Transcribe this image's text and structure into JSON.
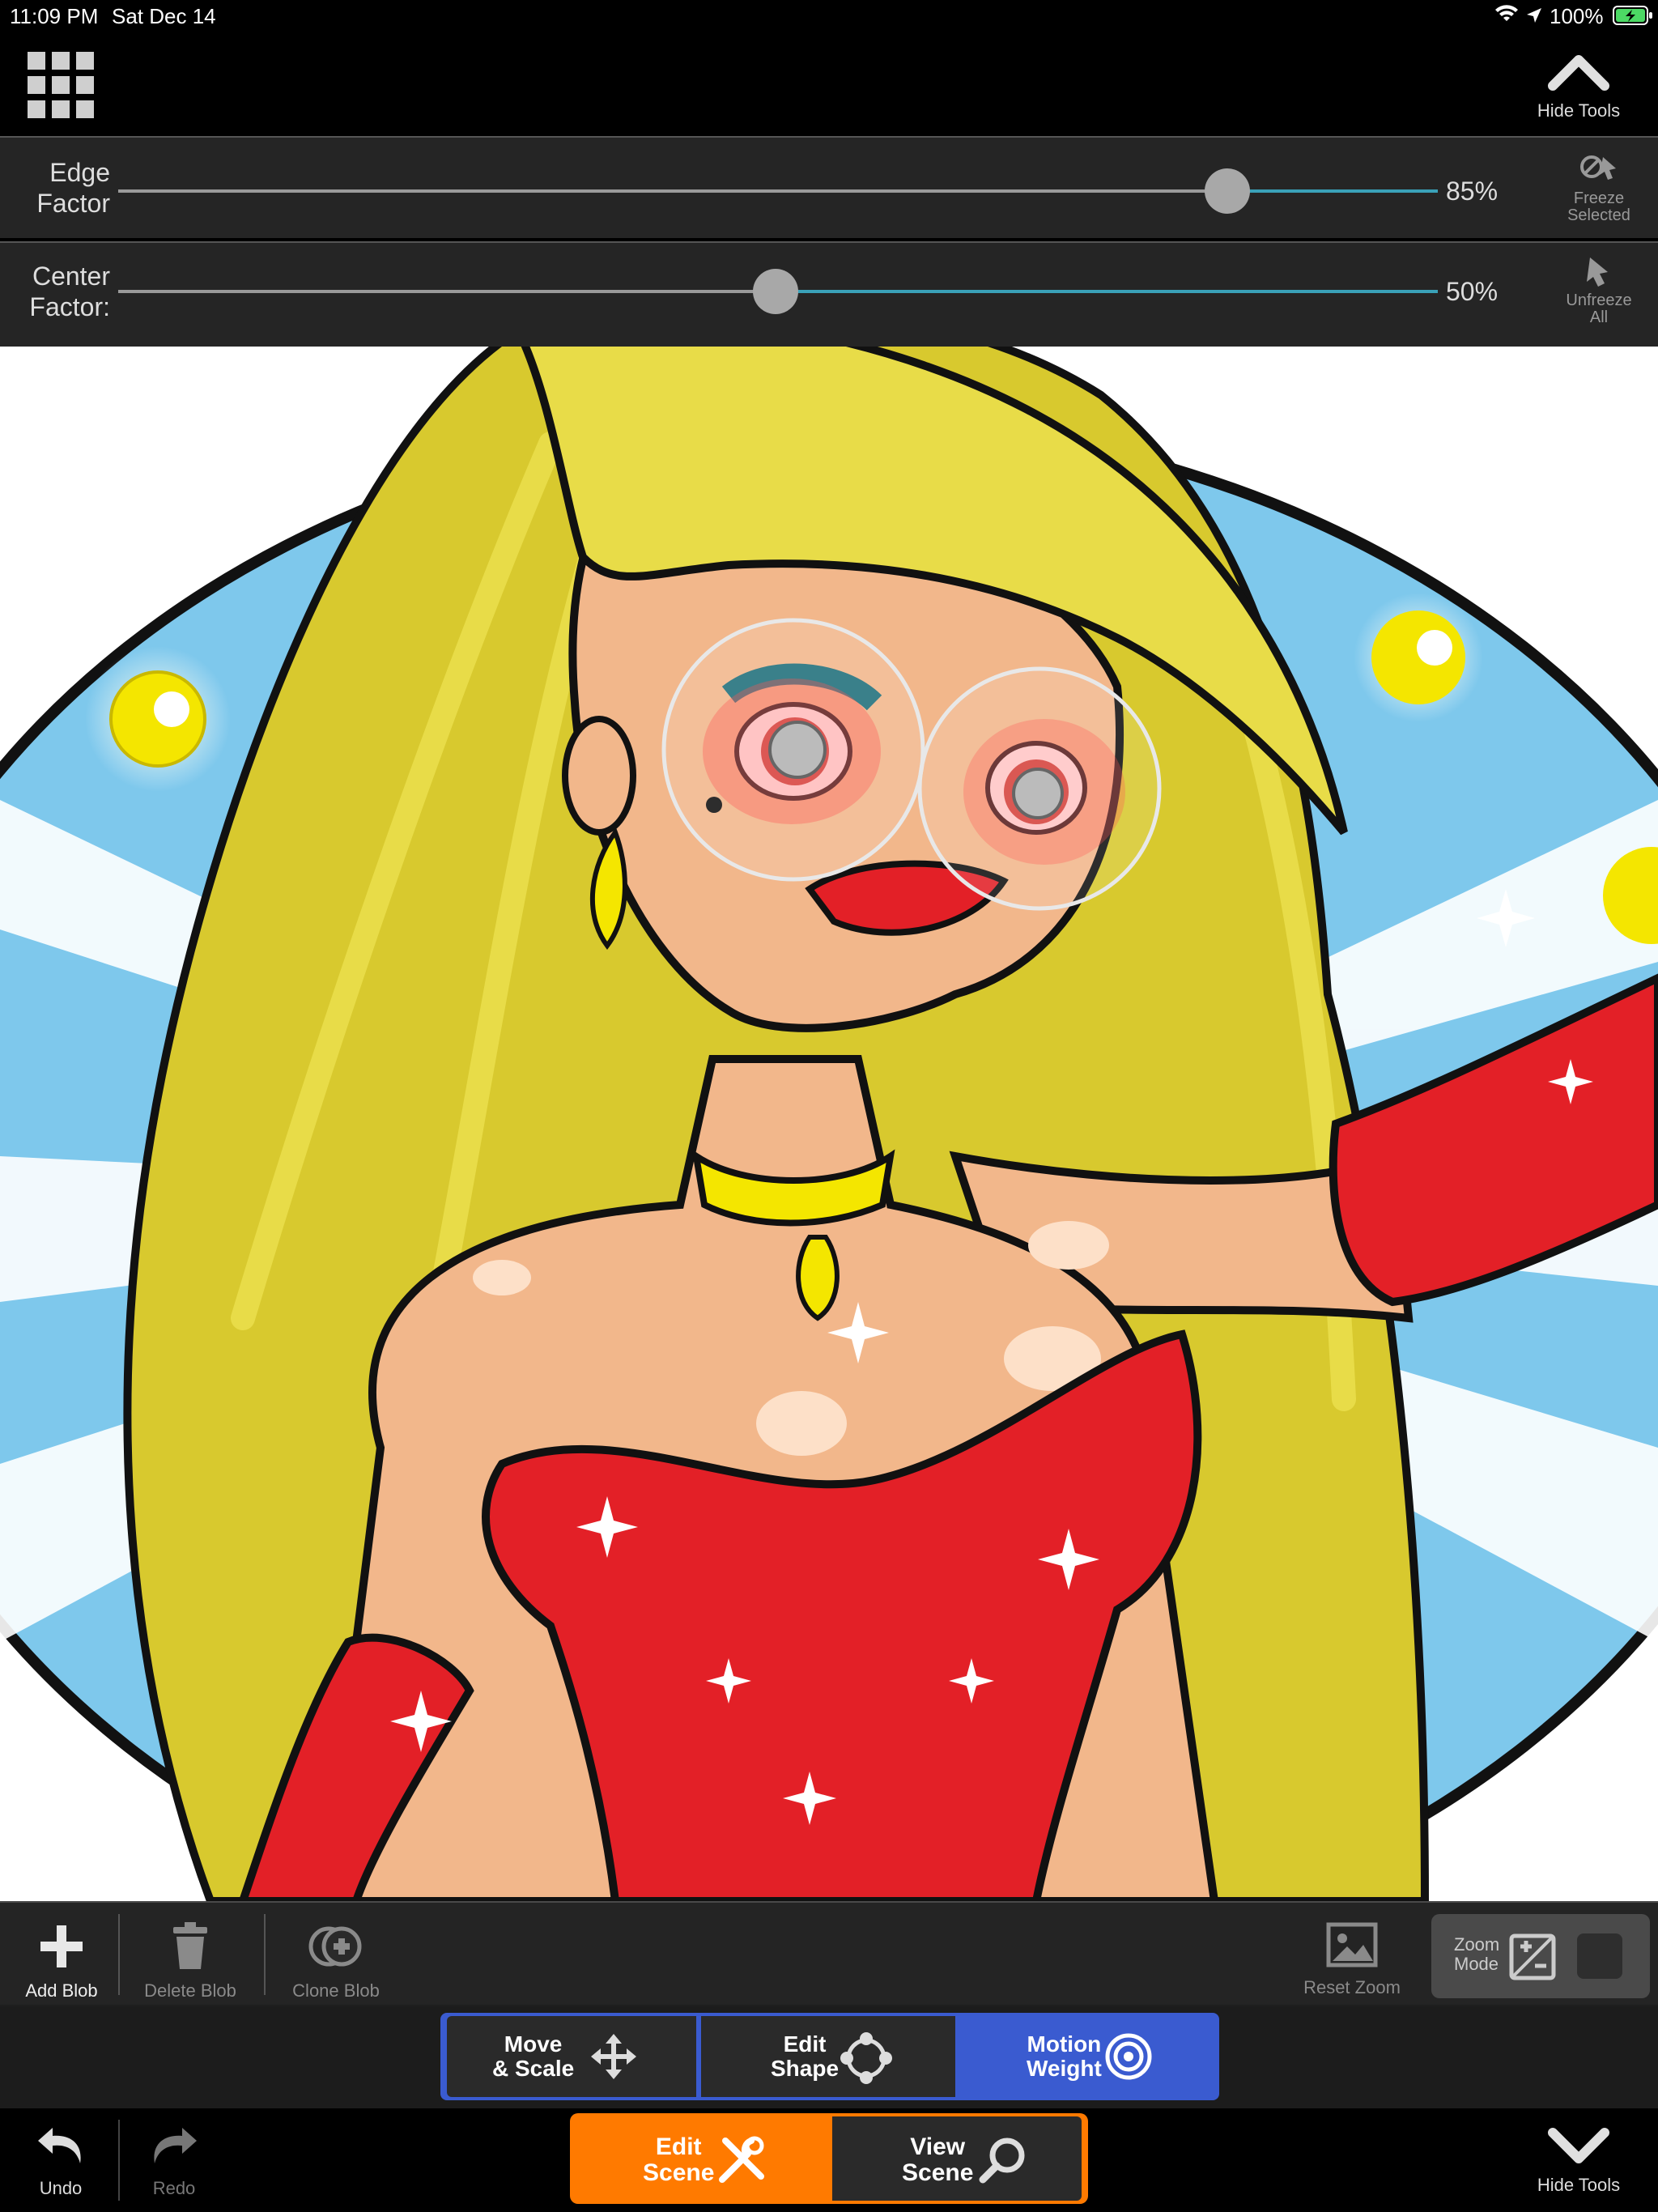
{
  "status": {
    "time": "11:09 PM",
    "date": "Sat Dec 14",
    "battery": "100%"
  },
  "top": {
    "hide_tools": "Hide Tools"
  },
  "sliders": {
    "edge": {
      "label_line1": "Edge",
      "label_line2": "Factor",
      "value": "85%",
      "fraction": 0.85
    },
    "center": {
      "label_line1": "Center",
      "label_line2": "Factor:",
      "value": "50%",
      "fraction": 0.5
    }
  },
  "side": {
    "freeze_line1": "Freeze",
    "freeze_line2": "Selected",
    "unfreeze_line1": "Unfreeze",
    "unfreeze_line2": "All"
  },
  "tools": {
    "add_blob": "Add Blob",
    "delete_blob": "Delete Blob",
    "clone_blob": "Clone Blob",
    "reset_zoom": "Reset Zoom",
    "zoom_mode_line1": "Zoom",
    "zoom_mode_line2": "Mode"
  },
  "modes": {
    "move_line1": "Move",
    "move_line2": "& Scale",
    "edit_line1": "Edit",
    "edit_line2": "Shape",
    "motion_line1": "Motion",
    "motion_line2": "Weight"
  },
  "bottom": {
    "undo": "Undo",
    "redo": "Redo",
    "edit_scene_line1": "Edit",
    "edit_scene_line2": "Scene",
    "view_scene_line1": "View",
    "view_scene_line2": "Scene",
    "hide_tools": "Hide Tools"
  },
  "colors": {
    "accent_orange": "#ff7a00",
    "accent_blue": "#3a5bd0",
    "slider_blue": "#3aa1b8"
  }
}
